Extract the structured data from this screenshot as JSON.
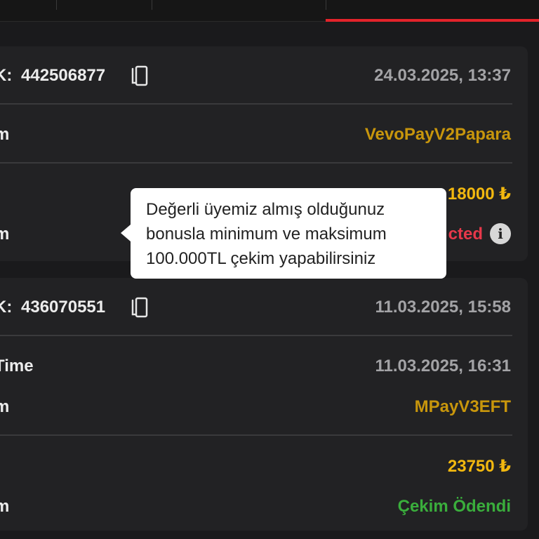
{
  "colors": {
    "accent": "#e3232a",
    "pending": "#c8960c",
    "amount": "#f2b80f",
    "rejected": "#e7384a",
    "paid": "#3aae3c"
  },
  "tooltip": {
    "lines": [
      "Değerli üyemiz almış olduğunuz",
      "bonusla minimum ve maksimum",
      "100.000TL çekim yapabilirsiniz"
    ]
  },
  "transactions": [
    {
      "id_label": "K:",
      "id_value": "442506877",
      "date": "24.03.2025, 13:37",
      "system_label": "m",
      "system_value": "VevoPayV2Papara",
      "amount": "18000 ₺",
      "status_label": "m",
      "status_value": "cted"
    },
    {
      "id_label": "K:",
      "id_value": "436070551",
      "date": "11.03.2025, 15:58",
      "time_label": "Time",
      "time_value": "11.03.2025, 16:31",
      "system_label": "m",
      "system_value": "MPayV3EFT",
      "amount": "23750 ₺",
      "status_label": "m",
      "status_value": "Çekim Ödendi"
    }
  ]
}
